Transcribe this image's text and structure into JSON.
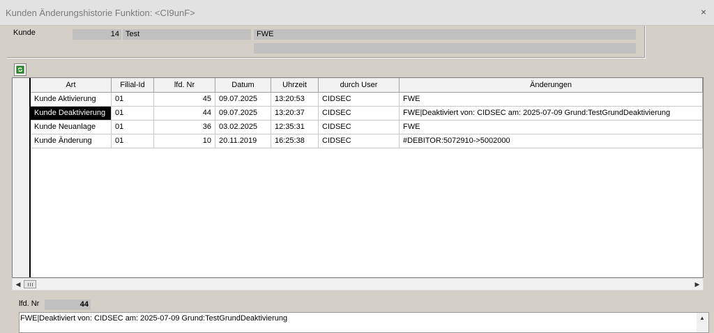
{
  "window": {
    "title": "Kunden Änderungshistorie Funktion: <CI9unF>",
    "close_glyph": "×"
  },
  "customer": {
    "label": "Kunde",
    "number": "14",
    "name": "Test",
    "code": "FWE",
    "extra": ""
  },
  "toolbar": {
    "refresh_icon": "refresh-icon"
  },
  "grid": {
    "columns": [
      "Art",
      "Filial-Id",
      "lfd. Nr",
      "Datum",
      "Uhrzeit",
      "durch User",
      "Änderungen"
    ],
    "rows": [
      [
        "Kunde Aktivierung",
        "01",
        "45",
        "09.07.2025",
        "13:20:53",
        "CIDSEC",
        "FWE"
      ],
      [
        "Kunde Deaktivierung",
        "01",
        "44",
        "09.07.2025",
        "13:20:37",
        "CIDSEC",
        "FWE|Deaktiviert von: CIDSEC am: 2025-07-09 Grund:TestGrundDeaktivierung"
      ],
      [
        "Kunde Neuanlage",
        "01",
        "36",
        "03.02.2025",
        "12:35:31",
        "CIDSEC",
        "FWE"
      ],
      [
        "Kunde Änderung",
        "01",
        "10",
        "20.11.2019",
        "16:25:38",
        "CIDSEC",
        "#DEBITOR:5072910->5002000"
      ]
    ],
    "selected_row": 1,
    "selected_col": 0
  },
  "detail": {
    "nr_label": "lfd. Nr",
    "nr_value": "44",
    "text": "FWE|Deaktiviert von: CIDSEC am: 2025-07-09 Grund:TestGrundDeaktivierung"
  },
  "colors": {
    "window_bg": "#d4d0c8",
    "selection_bg": "#000000",
    "grid_bg": "#ffffff"
  }
}
